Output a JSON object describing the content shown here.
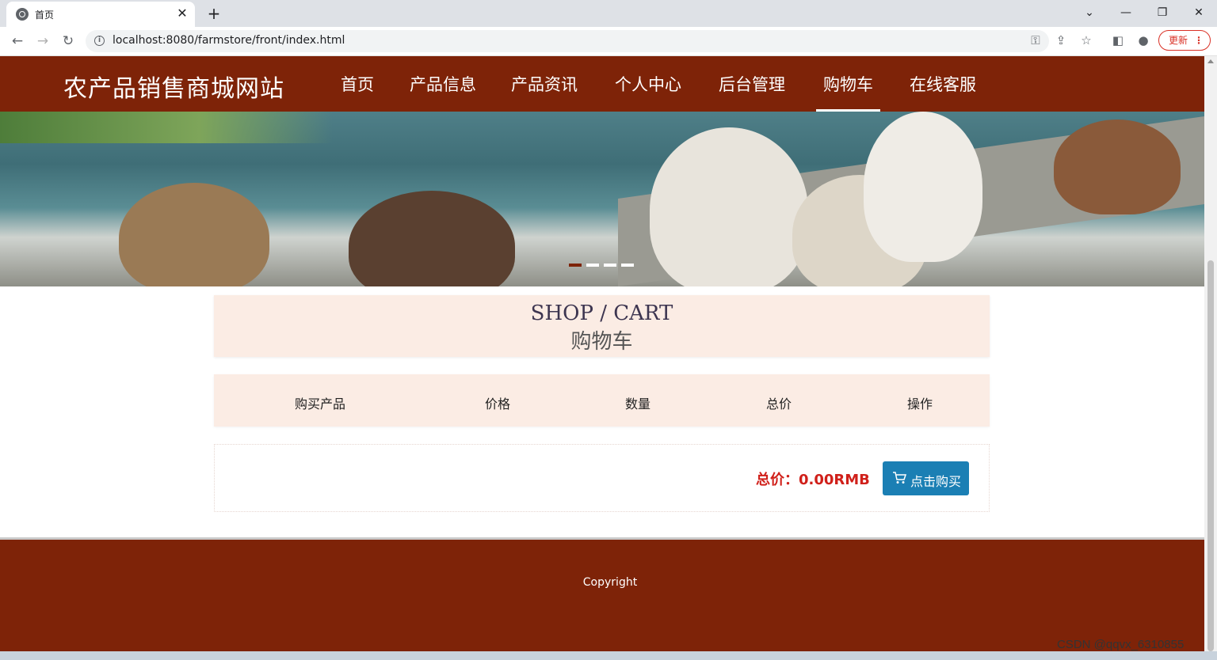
{
  "browser": {
    "tab_title": "首页",
    "url": "localhost:8080/farmstore/front/index.html",
    "update_label": "更新"
  },
  "site": {
    "title": "农产品销售商城网站",
    "nav": [
      "首页",
      "产品信息",
      "产品资讯",
      "个人中心",
      "后台管理",
      "购物车",
      "在线客服"
    ],
    "active_nav": "购物车"
  },
  "cart": {
    "title_en": "SHOP / CART",
    "title_cn": "购物车",
    "columns": [
      "购买产品",
      "价格",
      "数量",
      "总价",
      "操作"
    ],
    "total_label": "总价：0.00RMB",
    "buy_label": "点击购买"
  },
  "footer": {
    "copyright": "Copyright"
  },
  "watermark": "CSDN @qqvx_6310855",
  "colors": {
    "brand": "#7e2308",
    "accent_bg": "#fbece4",
    "buy_button": "#1b7fb4",
    "price_red": "#d0201a"
  },
  "carousel": {
    "slides": 4,
    "active_index": 0
  }
}
